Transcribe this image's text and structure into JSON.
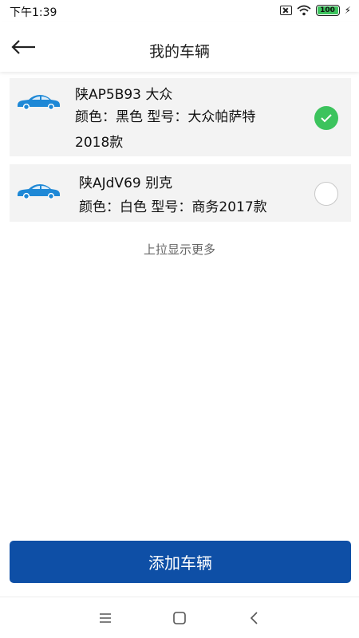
{
  "status_bar": {
    "time": "下午1:39",
    "battery": "100",
    "icons": [
      "sim-off-icon",
      "wifi-icon",
      "battery-icon",
      "charging-icon"
    ]
  },
  "header": {
    "title": "我的车辆",
    "back_icon": "arrow-left-icon"
  },
  "vehicles": [
    {
      "plate_line": "陕AP5B93  大众",
      "detail_line": "颜色：黑色 型号：大众帕萨特\n2018款",
      "selected": true,
      "icon": "car-icon"
    },
    {
      "plate_line": "陕AJdV69  别克",
      "detail_line": "颜色：白色 型号：商务2017款",
      "selected": false,
      "icon": "car-icon"
    }
  ],
  "load_more": "上拉显示更多",
  "add_button": {
    "label": "添加车辆"
  },
  "colors": {
    "accent": "#0e4fa6",
    "check_selected": "#3cc35d",
    "car_icon": "#1e88d6",
    "card_bg": "#f3f3f3"
  },
  "nav_bar": {
    "icons": [
      "menu-icon",
      "home-icon",
      "back-icon"
    ]
  }
}
